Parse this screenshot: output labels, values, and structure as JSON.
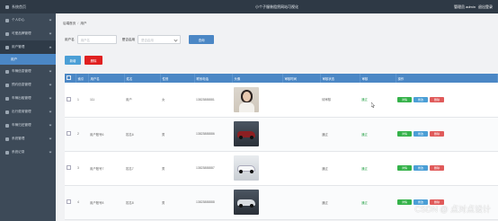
{
  "sidebar": {
    "brand": "系统首页",
    "items": [
      {
        "label": "个人中心"
      },
      {
        "label": "可爱品牌管理"
      },
      {
        "label": "用户管理",
        "active": true
      },
      {
        "label": "车辆信息管理"
      },
      {
        "label": "预约信息管理"
      },
      {
        "label": "车辆出租管理"
      },
      {
        "label": "出行费用管理"
      },
      {
        "label": "车辆归还管理"
      },
      {
        "label": "系统管理"
      },
      {
        "label": "系统记录"
      }
    ],
    "sub_item": "用户"
  },
  "topbar": {
    "title": "小个子服装租赁网站可视化",
    "user": "管理员 admin",
    "logout": "退出登录"
  },
  "breadcrumb": [
    "后端首页",
    "用户"
  ],
  "search": {
    "label1": "用户名",
    "placeholder1": "用户名",
    "label2": "是否启用",
    "placeholder2": "是否启用",
    "button": "查询"
  },
  "actions": {
    "add": "新增",
    "delete": "删除"
  },
  "table": {
    "columns": [
      "",
      "索引",
      "用户名",
      "姓名",
      "性别",
      "联系电话",
      "头像",
      "审核时间",
      "审核状态",
      "审核",
      "操作"
    ],
    "rows": [
      {
        "index": "1",
        "username": "111",
        "name": "用户",
        "gender": "女",
        "phone": "13823888881",
        "audit_state": "待审核",
        "audit": "通过",
        "image": "person"
      },
      {
        "index": "2",
        "username": "用户账号6",
        "name": "姓名6",
        "gender": "男",
        "phone": "13823888886",
        "audit_state": "通过",
        "audit": "通过",
        "image": "car-dark"
      },
      {
        "index": "3",
        "username": "用户账号7",
        "name": "姓名7",
        "gender": "男",
        "phone": "13823888887",
        "audit_state": "通过",
        "audit": "通过",
        "image": "car-light"
      },
      {
        "index": "4",
        "username": "用户账号8",
        "name": "姓名8",
        "gender": "男",
        "phone": "13823888888",
        "audit_state": "通过",
        "audit": "通过",
        "image": "car-grey"
      }
    ],
    "ops": {
      "detail": "详情",
      "edit": "修改",
      "delete": "删除"
    }
  },
  "watermark": "CSDN @ 点对点设计",
  "colors": {
    "sidebar": "#3d4a58",
    "header": "#2e3945",
    "accent": "#4b87c5",
    "danger": "#e02020",
    "success": "#35b24a"
  }
}
